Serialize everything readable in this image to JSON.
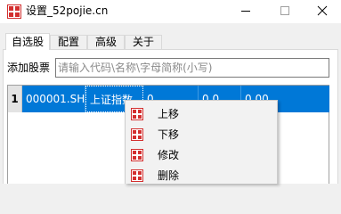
{
  "window": {
    "title": "设置_52pojie.cn"
  },
  "tabs": [
    {
      "label": "自选股",
      "active": true
    },
    {
      "label": "配置",
      "active": false
    },
    {
      "label": "高级",
      "active": false
    },
    {
      "label": "关于",
      "active": false
    }
  ],
  "add_stock": {
    "label": "添加股票",
    "placeholder": "请输入代码\\名称\\字母简称(小写)",
    "value": ""
  },
  "table": {
    "rows": [
      {
        "index": "1",
        "code": "000001.SH",
        "name": "上证指数",
        "col3": "0",
        "col4": "0.0",
        "col5": "0.00"
      }
    ]
  },
  "context_menu": {
    "items": [
      {
        "label": "上移",
        "icon": "stock-app-icon"
      },
      {
        "label": "下移",
        "icon": "stock-app-icon"
      },
      {
        "label": "修改",
        "icon": "stock-app-icon"
      },
      {
        "label": "删除",
        "icon": "stock-app-icon"
      }
    ]
  },
  "colors": {
    "selection": "#0078d7",
    "icon_red": "#d32f2f"
  }
}
